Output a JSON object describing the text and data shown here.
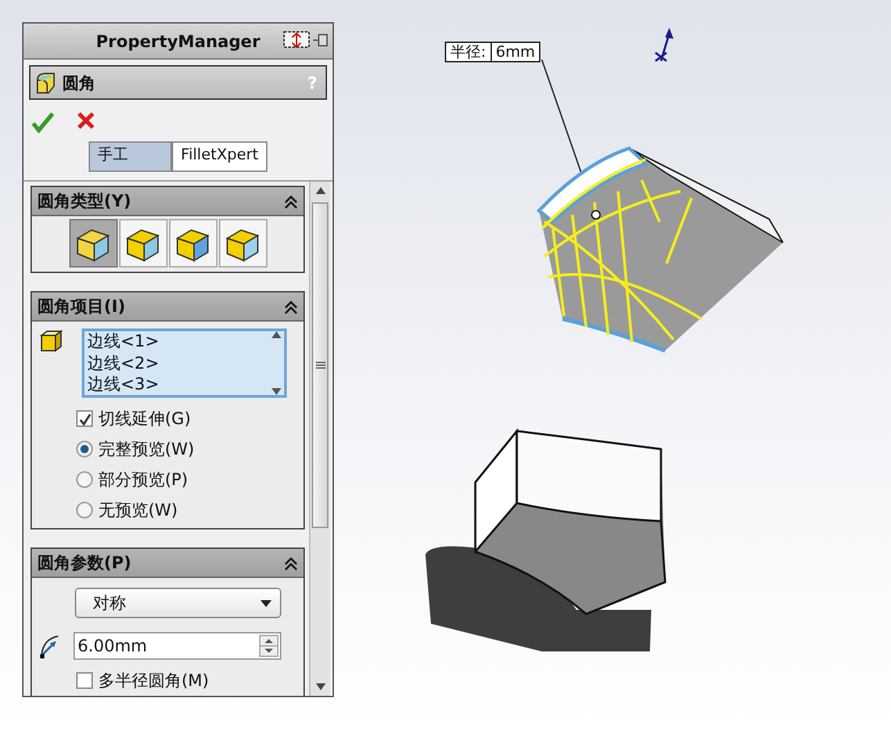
{
  "panel": {
    "title": "PropertyManager",
    "feature": {
      "title": "圆角",
      "help": "?"
    },
    "mode_tabs": [
      {
        "label": "手工",
        "selected": true
      },
      {
        "label": "FilletXpert",
        "selected": false
      }
    ],
    "fillet_type": {
      "title": "圆角类型(Y)",
      "options": [
        {
          "selected": true
        },
        {
          "selected": false
        },
        {
          "selected": false
        },
        {
          "selected": false
        }
      ]
    },
    "fillet_items": {
      "title": "圆角项目(I)",
      "edges": [
        "边线<1>",
        "边线<2>",
        "边线<3>"
      ],
      "tangent_propagation": {
        "label": "切线延伸(G)",
        "checked": true
      },
      "preview": [
        {
          "label": "完整预览(W)",
          "selected": true
        },
        {
          "label": "部分预览(P)",
          "selected": false
        },
        {
          "label": "无预览(W)",
          "selected": false
        }
      ]
    },
    "fillet_params": {
      "title": "圆角参数(P)",
      "method": "对称",
      "radius": "6.00mm",
      "multi_radius": {
        "label": "多半径圆角(M)",
        "checked": false
      }
    }
  },
  "viewport": {
    "radius_callout": {
      "label": "半径:",
      "value": "6mm"
    }
  }
}
